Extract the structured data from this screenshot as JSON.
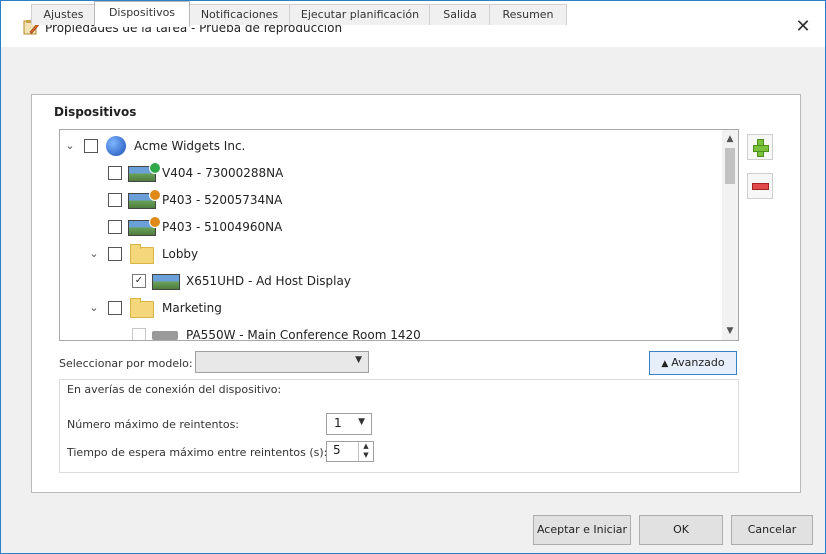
{
  "window": {
    "title": "Propiedades de la tarea - Prueba de reproducción"
  },
  "tabs": [
    {
      "label": "Ajustes"
    },
    {
      "label": "Dispositivos"
    },
    {
      "label": "Notificaciones"
    },
    {
      "label": "Ejecutar planificación"
    },
    {
      "label": "Salida"
    },
    {
      "label": "Resumen"
    }
  ],
  "active_tab": "Dispositivos",
  "devices_group_title": "Dispositivos",
  "tree": [
    {
      "label": "Acme Widgets Inc.",
      "icon": "globe-icon",
      "expanded": true,
      "checked": false
    },
    {
      "label": "V404 - 73000288NA",
      "icon": "display-icon",
      "status": "green",
      "checked": false
    },
    {
      "label": "P403 - 52005734NA",
      "icon": "display-icon",
      "status": "orange",
      "checked": false
    },
    {
      "label": "P403 - 51004960NA",
      "icon": "display-icon",
      "status": "orange",
      "checked": false
    },
    {
      "label": "Lobby",
      "icon": "folder-icon",
      "expanded": true,
      "checked": false
    },
    {
      "label": "X651UHD - Ad Host Display",
      "icon": "display-icon",
      "checked": true
    },
    {
      "label": "Marketing",
      "icon": "folder-icon",
      "expanded": true,
      "checked": false
    },
    {
      "label": "PA550W - Main Conference Room 1420",
      "icon": "projector-icon",
      "checked": false
    }
  ],
  "select_by_model": {
    "label": "Seleccionar por modelo:",
    "value": ""
  },
  "advanced_button": "Avanzado",
  "connection_errors": {
    "legend": "En averías de conexión del dispositivo:",
    "max_retries_label": "Número máximo de reintentos:",
    "max_retries_value": "1",
    "max_wait_label": "Tiempo de espera máximo entre reintentos (s):",
    "max_wait_value": "5"
  },
  "buttons": {
    "accept_start": "Aceptar e Iniciar",
    "ok": "OK",
    "cancel": "Cancelar"
  },
  "colors": {
    "window_border": "#2b7fc8",
    "add_button": "#7cc13b",
    "remove_button": "#e04a4a",
    "status_green": "#2fa84a",
    "status_orange": "#e08a1a"
  }
}
